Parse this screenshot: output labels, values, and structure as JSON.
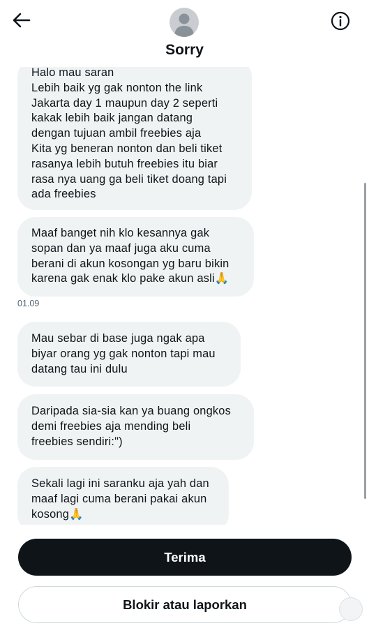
{
  "header": {
    "contact_name": "Sorry"
  },
  "icons": {
    "back": "back-arrow-icon",
    "info": "info-icon",
    "avatar": "default-avatar-icon"
  },
  "messages": [
    {
      "lines": [
        "Halo mau saran",
        "Lebih baik yg gak nonton the link",
        "Jakarta day 1 maupun day 2 seperti",
        "kakak lebih baik jangan datang",
        "dengan tujuan ambil freebies aja",
        "Kita yg beneran nonton dan beli tiket",
        "rasanya lebih butuh freebies itu biar",
        "rasa nya uang ga beli tiket doang tapi",
        "ada freebies"
      ]
    },
    {
      "lines": [
        "Maaf banget nih klo kesannya gak",
        "sopan dan ya maaf juga aku cuma",
        "berani di akun kosongan yg baru bikin",
        "karena gak enak klo pake akun asli🙏"
      ]
    },
    {
      "lines": [
        "Mau sebar di base juga ngak apa",
        "biyar orang yg gak nonton tapi mau",
        "datang tau ini dulu"
      ]
    },
    {
      "lines": [
        "Daripada sia-sia kan ya buang ongkos",
        "demi freebies aja mending beli",
        "freebies sendiri:\")"
      ]
    },
    {
      "lines": [
        "Sekali lagi ini saranku aja yah dan",
        "maaf lagi cuma berani pakai akun",
        "kosong🙏"
      ]
    }
  ],
  "timestamp": "01.09",
  "actions": {
    "accept_label": "Terima",
    "block_label": "Blokir atau laporkan"
  },
  "colors": {
    "bubble_bg": "#eff3f4",
    "text_primary": "#0f1419",
    "text_secondary": "#536471",
    "button_dark": "#0f1419",
    "button_border": "#cfd9de"
  }
}
